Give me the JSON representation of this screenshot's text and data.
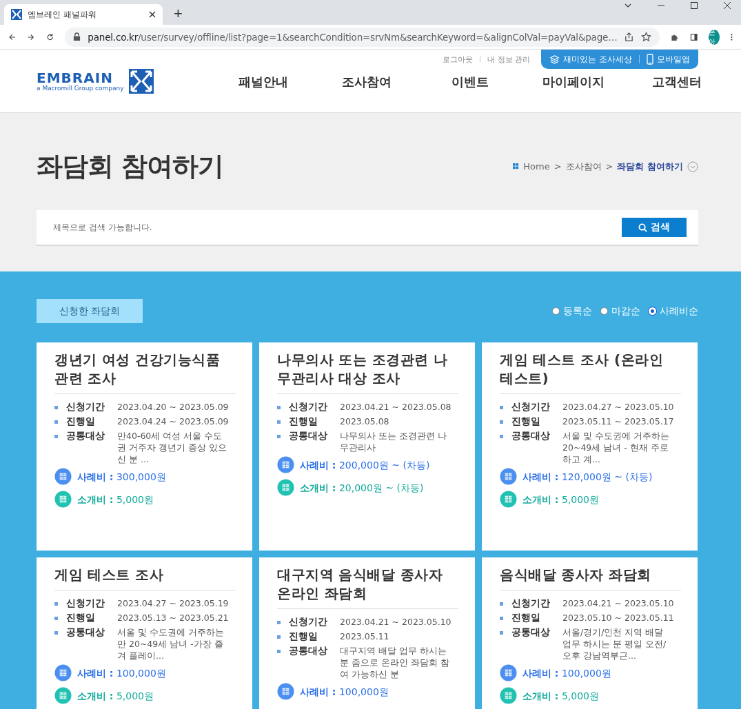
{
  "browser": {
    "tab_title": "엠브레인 패널파워",
    "new_tab": "+",
    "url_host": "panel.co.kr",
    "url_path": "/user/survey/offline/list?page=1&searchCondition=srvNm&searchKeyword=&alignColVal=payVal&page…",
    "profile": "은아"
  },
  "header": {
    "top_links": [
      "로그아웃",
      "내 정보 관리"
    ],
    "top_buttons": [
      {
        "kind": "layers",
        "label": "재미있는 조사세상"
      },
      {
        "kind": "mobile",
        "label": "모바일앱"
      }
    ],
    "logo": {
      "name": "EMBRAIN",
      "tagline": "a Macromill Group company"
    },
    "nav": [
      "패널안내",
      "조사참여",
      "이벤트",
      "마이페이지",
      "고객센터"
    ]
  },
  "page_title": "좌담회 참여하기",
  "breadcrumb": {
    "items": [
      "Home",
      "조사참여",
      "좌담회 참여하기"
    ],
    "separator": ">"
  },
  "search": {
    "placeholder": "제목으로 검색 가능합니다.",
    "button": "검색"
  },
  "applied_button": "신청한 좌담회",
  "sort_options": [
    {
      "label": "등록순",
      "selected": false
    },
    {
      "label": "마감순",
      "selected": false
    },
    {
      "label": "사례비순",
      "selected": true
    }
  ],
  "cards": [
    {
      "title": "갱년기 여성 건강기능식품 관련 조사",
      "rows": [
        {
          "label": "신청기간",
          "value": "2023.04.20 ~ 2023.05.09"
        },
        {
          "label": "진행일",
          "value": "2023.04.24 ~ 2023.05.09"
        },
        {
          "label": "공통대상",
          "value": "만40-60세 여성 서울 수도권 거주자 갱년기 증상 있으신 분 ..."
        }
      ],
      "fees": [
        {
          "kind": "reward",
          "label": "사례비 :",
          "amount": "300,000원"
        },
        {
          "kind": "referral",
          "label": "소개비 :",
          "amount": "5,000원"
        }
      ]
    },
    {
      "title": "나무의사 또는 조경관련 나무관리사 대상 조사",
      "rows": [
        {
          "label": "신청기간",
          "value": "2023.04.21 ~ 2023.05.08"
        },
        {
          "label": "진행일",
          "value": "2023.05.08"
        },
        {
          "label": "공통대상",
          "value": "나무의사 또는 조경관련 나무관리사"
        }
      ],
      "fees": [
        {
          "kind": "reward",
          "label": "사례비 :",
          "amount": "200,000원 ~ (차등)"
        },
        {
          "kind": "referral",
          "label": "소개비 :",
          "amount": "20,000원 ~ (차등)"
        }
      ]
    },
    {
      "title": "게임 테스트 조사 (온라인 테스트)",
      "rows": [
        {
          "label": "신청기간",
          "value": "2023.04.27 ~ 2023.05.10"
        },
        {
          "label": "진행일",
          "value": "2023.05.11 ~ 2023.05.17"
        },
        {
          "label": "공통대상",
          "value": "서울 및 수도권에 거주하는 20~49세 남녀 - 현재 주로 하고 계..."
        }
      ],
      "fees": [
        {
          "kind": "reward",
          "label": "사례비 :",
          "amount": "120,000원 ~ (차등)"
        },
        {
          "kind": "referral",
          "label": "소개비 :",
          "amount": "5,000원"
        }
      ]
    },
    {
      "title": "게임 테스트 조사",
      "rows": [
        {
          "label": "신청기간",
          "value": "2023.04.27 ~ 2023.05.19"
        },
        {
          "label": "진행일",
          "value": "2023.05.13 ~ 2023.05.21"
        },
        {
          "label": "공통대상",
          "value": "서울 및 수도권에 거주하는 만 20~49세 남녀 -가장 즐겨 플레이..."
        }
      ],
      "fees": [
        {
          "kind": "reward",
          "label": "사례비 :",
          "amount": "100,000원"
        },
        {
          "kind": "referral",
          "label": "소개비 :",
          "amount": "5,000원"
        }
      ]
    },
    {
      "title": "대구지역 음식배달 종사자 온라인 좌담회",
      "rows": [
        {
          "label": "신청기간",
          "value": "2023.04.21 ~ 2023.05.10"
        },
        {
          "label": "진행일",
          "value": "2023.05.11"
        },
        {
          "label": "공통대상",
          "value": "대구지역 배달 업무 하시는 분 줌으로 온라인 좌담회 참여 가능하신 분"
        }
      ],
      "fees": [
        {
          "kind": "reward",
          "label": "사례비 :",
          "amount": "100,000원"
        }
      ]
    },
    {
      "title": "음식배달 종사자 좌담회",
      "rows": [
        {
          "label": "신청기간",
          "value": "2023.04.21 ~ 2023.05.10"
        },
        {
          "label": "진행일",
          "value": "2023.05.10 ~ 2023.05.11"
        },
        {
          "label": "공통대상",
          "value": "서울/경기/인천 지역 배달 업무 하시는 분 평일 오전/오후 강남역부근..."
        }
      ],
      "fees": [
        {
          "kind": "reward",
          "label": "사례비 :",
          "amount": "100,000원"
        },
        {
          "kind": "referral",
          "label": "소개비 :",
          "amount": "5,000원"
        }
      ]
    }
  ]
}
